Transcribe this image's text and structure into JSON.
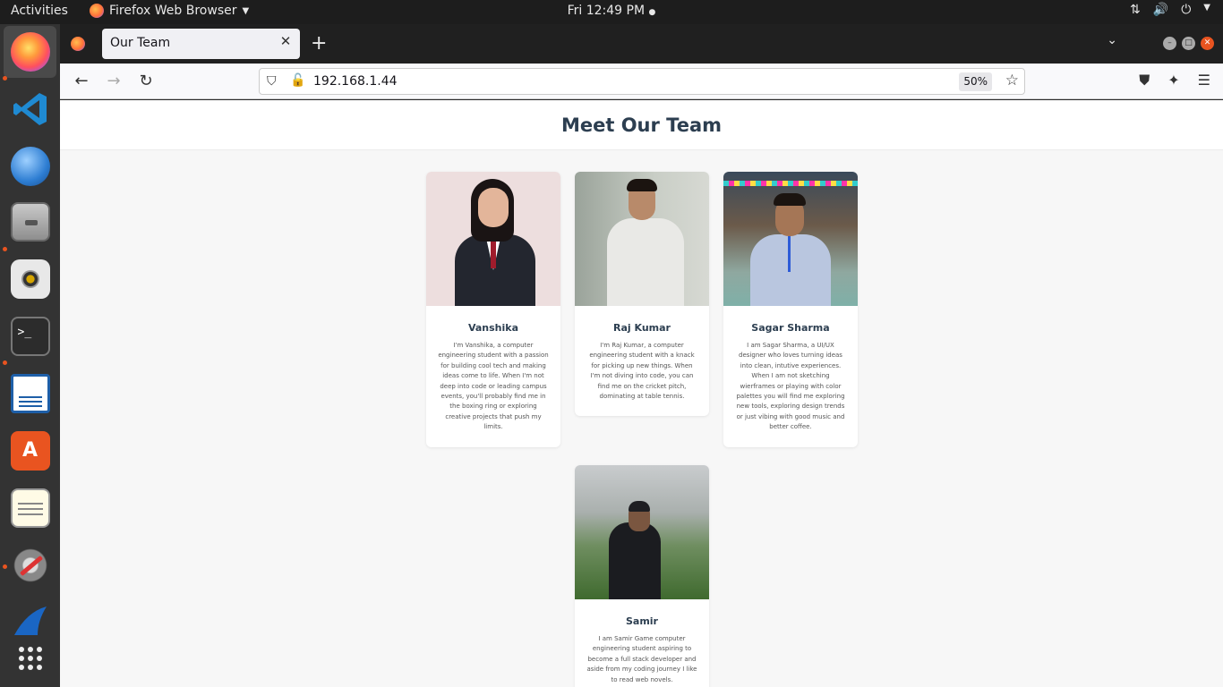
{
  "topbar": {
    "activities": "Activities",
    "app_name": "Firefox Web Browser",
    "clock": "Fri 12:49 PM"
  },
  "dock": {
    "items": [
      "Firefox",
      "Visual Studio Code",
      "Thunderbird",
      "Files",
      "Rhythmbox",
      "Terminal",
      "LibreOffice Writer",
      "Ubuntu Software",
      "Text Editor",
      "Settings",
      "Wireshark",
      "Show Applications"
    ]
  },
  "browser": {
    "tab_title": "Our Team",
    "url": "192.168.1.44",
    "zoom": "50%"
  },
  "page": {
    "heading": "Meet Our Team",
    "members": [
      {
        "name": "Vanshika",
        "bio": "I'm Vanshika, a computer engineering student with a passion for building cool tech and making ideas come to life. When I'm not deep into code or leading campus events, you'll probably find me in the boxing ring or exploring creative projects that push my limits."
      },
      {
        "name": "Raj Kumar",
        "bio": "I'm Raj Kumar, a computer engineering student with a knack for picking up new things. When I'm not diving into code, you can find me on the cricket pitch, dominating at table tennis."
      },
      {
        "name": "Sagar Sharma",
        "bio": "I am Sagar Sharma, a UI/UX designer who loves turning ideas into clean, intutive experiences. When I am not sketching wierframes or playing with color palettes you will find me exploring new tools, exploring design trends or just vibing with good music and better coffee."
      },
      {
        "name": "Samir",
        "bio": "I am Samir Game computer engineering student aspiring to become a full stack developer and aside from my coding journey I like to read web novels."
      }
    ]
  }
}
